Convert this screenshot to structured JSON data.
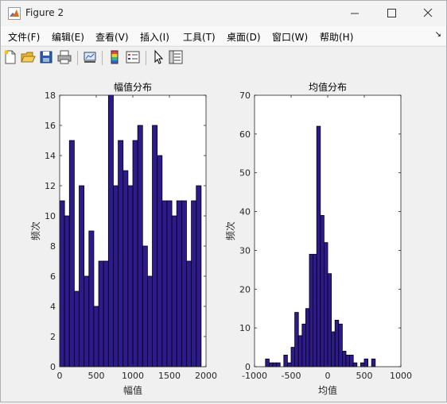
{
  "window": {
    "title": "Figure 2"
  },
  "menu": [
    "文件(F)",
    "编辑(E)",
    "查看(V)",
    "插入(I)",
    "工具(T)",
    "桌面(D)",
    "窗口(W)",
    "帮助(H)"
  ],
  "toolbar": [
    {
      "name": "new-figure-icon"
    },
    {
      "name": "open-file-icon"
    },
    {
      "name": "save-icon"
    },
    {
      "name": "print-icon"
    },
    {
      "name": "link-plot-icon"
    },
    {
      "name": "colorbar-icon"
    },
    {
      "name": "legend-icon"
    },
    {
      "name": "pointer-icon"
    },
    {
      "name": "property-inspector-icon"
    }
  ],
  "chart_data": [
    {
      "type": "bar",
      "title": "幅值分布",
      "xlabel": "幅值",
      "ylabel": "频次",
      "xlim": [
        0,
        2000
      ],
      "ylim": [
        0,
        18
      ],
      "xticks": [
        0,
        500,
        1000,
        1500,
        2000
      ],
      "yticks": [
        0,
        2,
        4,
        6,
        8,
        10,
        12,
        14,
        16,
        18
      ],
      "bin_edges_start": 0,
      "bin_width": 66.67,
      "values": [
        11,
        10,
        15,
        5,
        12,
        6,
        9,
        4,
        7,
        7,
        18,
        12,
        15,
        13,
        12,
        15,
        16,
        8,
        6,
        16,
        14,
        11,
        11,
        10,
        11,
        11,
        7,
        11,
        12
      ],
      "bar_color": "#2e1a8c"
    },
    {
      "type": "bar",
      "title": "均值分布",
      "xlabel": "均值",
      "ylabel": "频次",
      "xlim": [
        -1000,
        1000
      ],
      "ylim": [
        0,
        70
      ],
      "xticks": [
        -1000,
        -500,
        0,
        500,
        1000
      ],
      "yticks": [
        0,
        10,
        20,
        30,
        40,
        50,
        60,
        70
      ],
      "bin_edges_start": -850,
      "bin_width": 50,
      "values": [
        2,
        1,
        1,
        1,
        0,
        3,
        1,
        5,
        14,
        8,
        11,
        15,
        29,
        29,
        62,
        39,
        32,
        24,
        9,
        12,
        11,
        4,
        3,
        3,
        1,
        0,
        1,
        2,
        0,
        2
      ],
      "bar_color": "#2e1a8c"
    }
  ]
}
